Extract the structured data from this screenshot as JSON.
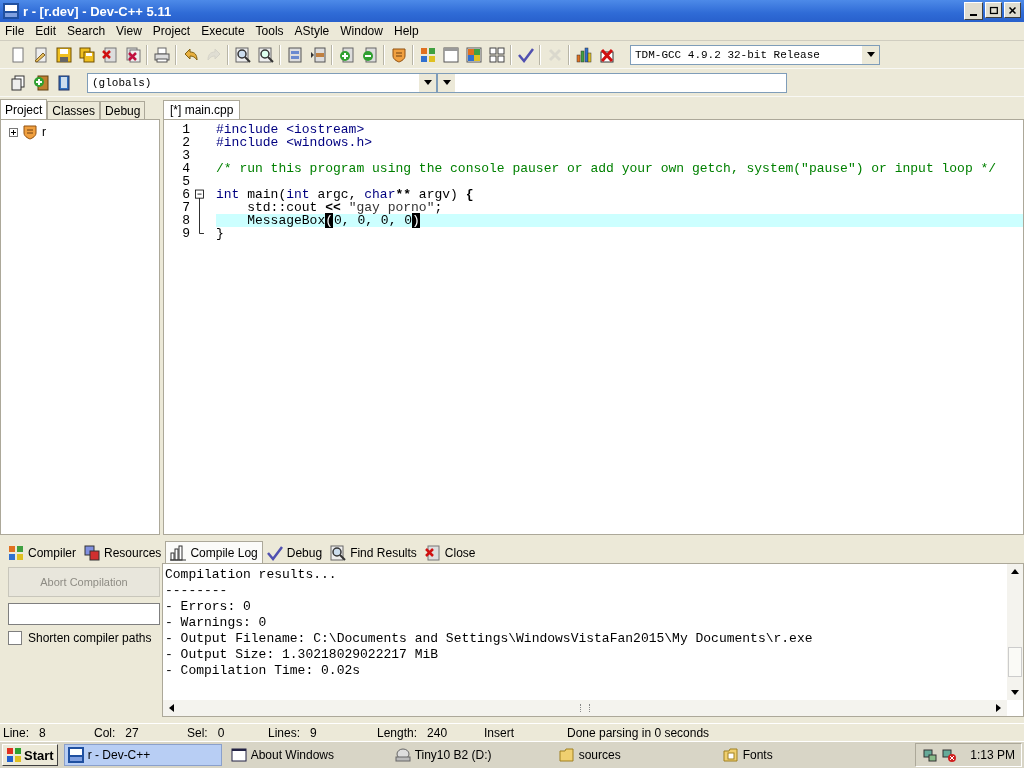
{
  "window": {
    "title": "r - [r.dev] - Dev-C++ 5.11"
  },
  "menu": [
    "File",
    "Edit",
    "Search",
    "View",
    "Project",
    "Execute",
    "Tools",
    "AStyle",
    "Window",
    "Help"
  ],
  "toolbar": [
    {
      "kind": "new",
      "disabled": false
    },
    {
      "kind": "open",
      "disabled": false
    },
    {
      "kind": "save",
      "disabled": false
    },
    {
      "kind": "save-all",
      "disabled": false
    },
    {
      "kind": "close",
      "disabled": false
    },
    {
      "kind": "close-all",
      "disabled": false
    },
    {
      "kind": "separator"
    },
    {
      "kind": "print",
      "disabled": false
    },
    {
      "kind": "separator"
    },
    {
      "kind": "undo",
      "disabled": false
    },
    {
      "kind": "redo",
      "disabled": true
    },
    {
      "kind": "separator"
    },
    {
      "kind": "find",
      "disabled": false
    },
    {
      "kind": "replace",
      "disabled": false
    },
    {
      "kind": "separator"
    },
    {
      "kind": "indent",
      "disabled": false
    },
    {
      "kind": "unindent",
      "disabled": false
    },
    {
      "kind": "separator"
    },
    {
      "kind": "add",
      "disabled": false
    },
    {
      "kind": "remove",
      "disabled": false
    },
    {
      "kind": "separator"
    },
    {
      "kind": "options",
      "disabled": false
    },
    {
      "kind": "separator"
    },
    {
      "kind": "compile",
      "disabled": false
    },
    {
      "kind": "run",
      "disabled": false
    },
    {
      "kind": "compile-run",
      "disabled": false
    },
    {
      "kind": "rebuild",
      "disabled": false
    },
    {
      "kind": "separator"
    },
    {
      "kind": "check",
      "disabled": false
    },
    {
      "kind": "separator"
    },
    {
      "kind": "stop",
      "disabled": true
    },
    {
      "kind": "separator"
    },
    {
      "kind": "chart",
      "disabled": false
    },
    {
      "kind": "delete",
      "disabled": false
    }
  ],
  "compiler_select": {
    "value": "TDM-GCC 4.9.2 32-bit Release"
  },
  "toolbar2": [
    {
      "kind": "windows",
      "disabled": false
    },
    {
      "kind": "plus",
      "disabled": false
    },
    {
      "kind": "bookmark",
      "disabled": false
    }
  ],
  "scope_select": {
    "value": "(globals)"
  },
  "side_tabs": [
    {
      "label": "Project",
      "selected": true
    },
    {
      "label": "Classes",
      "selected": false
    },
    {
      "label": "Debug",
      "selected": false
    }
  ],
  "project_tree": [
    {
      "label": "r",
      "expanded": false
    }
  ],
  "editor_tabs": [
    {
      "label": "[*] main.cpp",
      "selected": true
    }
  ],
  "code": [
    {
      "number": "1",
      "kind": "plain",
      "current": false,
      "tokens": [
        {
          "kind": "preproc",
          "text": "#include <iostream>"
        }
      ]
    },
    {
      "number": "2",
      "kind": "plain",
      "current": false,
      "tokens": [
        {
          "kind": "preproc",
          "text": "#include <windows.h>"
        }
      ]
    },
    {
      "number": "3",
      "kind": "plain",
      "current": false
    },
    {
      "number": "4",
      "kind": "plain",
      "current": false,
      "tokens": [
        {
          "kind": "comment",
          "text": "/* run this program using the console pauser or add your own getch, system(\"pause\") or input loop */"
        }
      ]
    },
    {
      "number": "5",
      "kind": "plain",
      "current": false
    },
    {
      "number": "6",
      "kind": "fold-start",
      "current": false,
      "tokens": [
        {
          "kind": "keyword",
          "text": "int"
        },
        {
          "kind": "plain",
          "text": " main("
        },
        {
          "kind": "keyword",
          "text": "int"
        },
        {
          "kind": "plain",
          "text": " argc, "
        },
        {
          "kind": "keyword",
          "text": "char"
        },
        {
          "kind": "symbol",
          "text": "**"
        },
        {
          "kind": "plain",
          "text": " argv) "
        },
        {
          "kind": "symbol",
          "text": "{"
        }
      ]
    },
    {
      "number": "7",
      "kind": "fold-body",
      "current": false,
      "tokens": [
        {
          "kind": "plain",
          "text": "    std::cout "
        },
        {
          "kind": "symbol",
          "text": "<<"
        },
        {
          "kind": "string",
          "text": " \"gay porno\""
        },
        {
          "kind": "plain",
          "text": ";"
        }
      ]
    },
    {
      "number": "8",
      "kind": "fold-body",
      "current": true,
      "tokens": [
        {
          "kind": "plain",
          "text": "    MessageBox"
        },
        {
          "kind": "match",
          "text": "("
        },
        {
          "kind": "plain",
          "text": "0, 0, 0, 0"
        },
        {
          "kind": "match",
          "text": ")"
        }
      ]
    },
    {
      "number": "9",
      "kind": "fold-end",
      "current": false,
      "tokens": [
        {
          "kind": "plain",
          "text": "}"
        }
      ]
    }
  ],
  "bottom_tabs": [
    {
      "label": "Compiler",
      "kind": "compiler",
      "selected": false
    },
    {
      "label": "Resources",
      "kind": "resources",
      "selected": false
    },
    {
      "label": "Compile Log",
      "kind": "log",
      "selected": true
    },
    {
      "label": "Debug",
      "kind": "debug",
      "selected": false
    },
    {
      "label": "Find Results",
      "kind": "find",
      "selected": false
    },
    {
      "label": "Close",
      "kind": "close",
      "selected": false
    }
  ],
  "abort_button": {
    "label": "Abort Compilation",
    "disabled": true
  },
  "shorten_paths": {
    "label": "Shorten compiler paths",
    "checked": false
  },
  "compile_log": [
    "Compilation results...",
    "--------",
    "- Errors: 0",
    "- Warnings: 0",
    "- Output Filename: C:\\Documents and Settings\\WindowsVistaFan2015\\My Documents\\r.exe",
    "- Output Size: 1.30218029022217 MiB",
    "- Compilation Time: 0.02s"
  ],
  "status_bar": [
    {
      "label": "Line:",
      "value": "8"
    },
    {
      "label": "Col:",
      "value": "27"
    },
    {
      "label": "Sel:",
      "value": "0"
    },
    {
      "label": "Lines:",
      "value": "9"
    },
    {
      "label": "Length:",
      "value": "240"
    },
    {
      "value": "Insert"
    },
    {
      "value": "Done parsing in 0 seconds"
    }
  ],
  "taskbar": {
    "start": "Start",
    "items": [
      {
        "label": "r - Dev-C++",
        "kind": "devcpp",
        "selected": true
      },
      {
        "label": "About Windows",
        "kind": "window",
        "selected": false
      },
      {
        "label": "Tiny10 B2 (D:)",
        "kind": "drive",
        "selected": false
      },
      {
        "label": "sources",
        "kind": "folder",
        "selected": false
      },
      {
        "label": "Fonts",
        "kind": "folder-fonts",
        "selected": false
      }
    ],
    "clock": "1:13 PM"
  }
}
